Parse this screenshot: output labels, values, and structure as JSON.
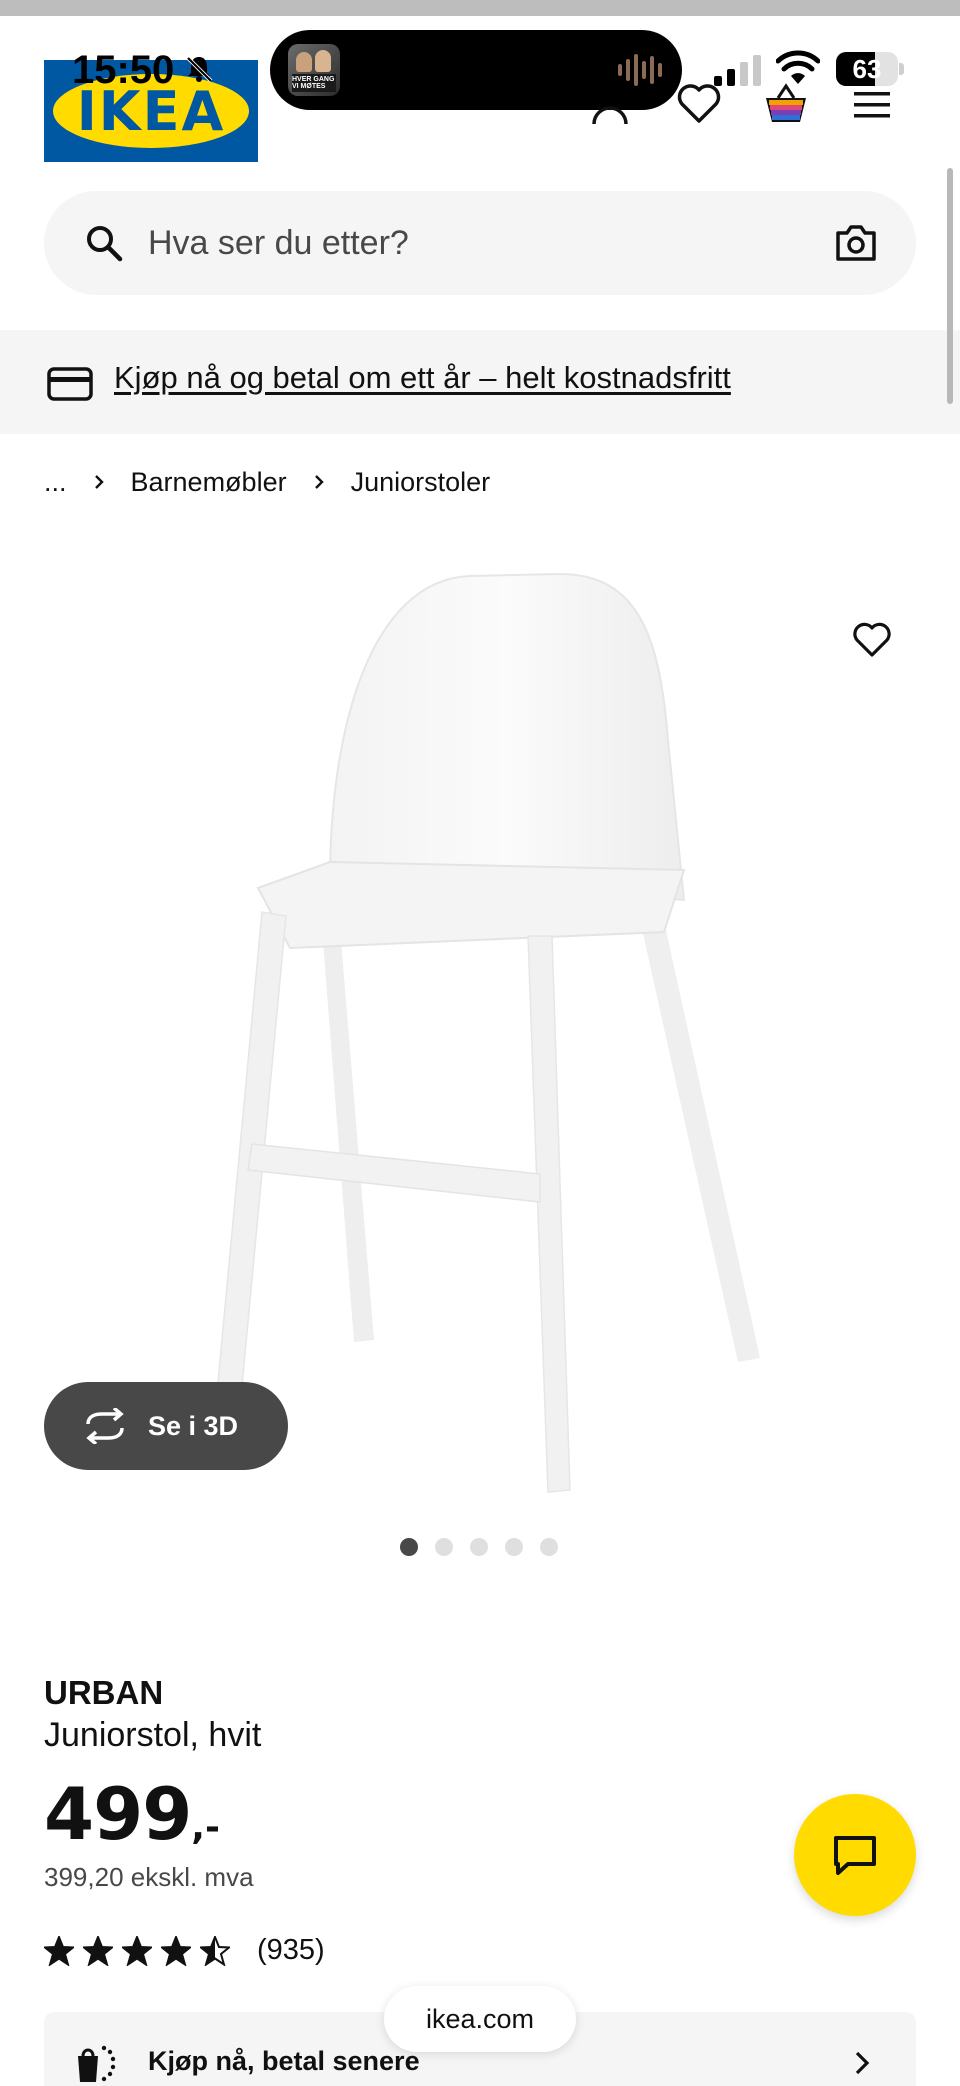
{
  "status_bar": {
    "time": "15:50",
    "battery": "63",
    "battery_level": 0.63,
    "media_art_text": "HVER GANG VI MØTES"
  },
  "header": {
    "logo_text": "IKEA",
    "icons": [
      "bell-slash-icon",
      "signal-icon",
      "wifi-icon",
      "user-icon",
      "heart-icon",
      "shopping-bag-icon",
      "menu-icon"
    ]
  },
  "search": {
    "placeholder": "Hva ser du etter?"
  },
  "promo": {
    "text": "Kjøp nå og betal om ett år – helt kostnadsfritt"
  },
  "breadcrumb": {
    "ellipsis": "...",
    "items": [
      "Barnemøbler",
      "Juniorstoler"
    ]
  },
  "gallery": {
    "view_3d_label": "Se i 3D",
    "dot_count": 5,
    "active_dot": 0
  },
  "product": {
    "name": "URBAN",
    "description": "Juniorstol, hvit",
    "price": "499",
    "price_suffix": ",-",
    "price_ex_vat": "399,20 ekskl. mva",
    "rating_stars": 4.5,
    "rating_count": "(935)"
  },
  "buy_later": {
    "label": "Kjøp nå, betal senere"
  },
  "browser": {
    "url": "ikea.com"
  },
  "colors": {
    "ikea_blue": "#0058a3",
    "ikea_yellow": "#ffdb00",
    "dark_pill": "#484848",
    "light_gray": "#f5f5f5"
  }
}
